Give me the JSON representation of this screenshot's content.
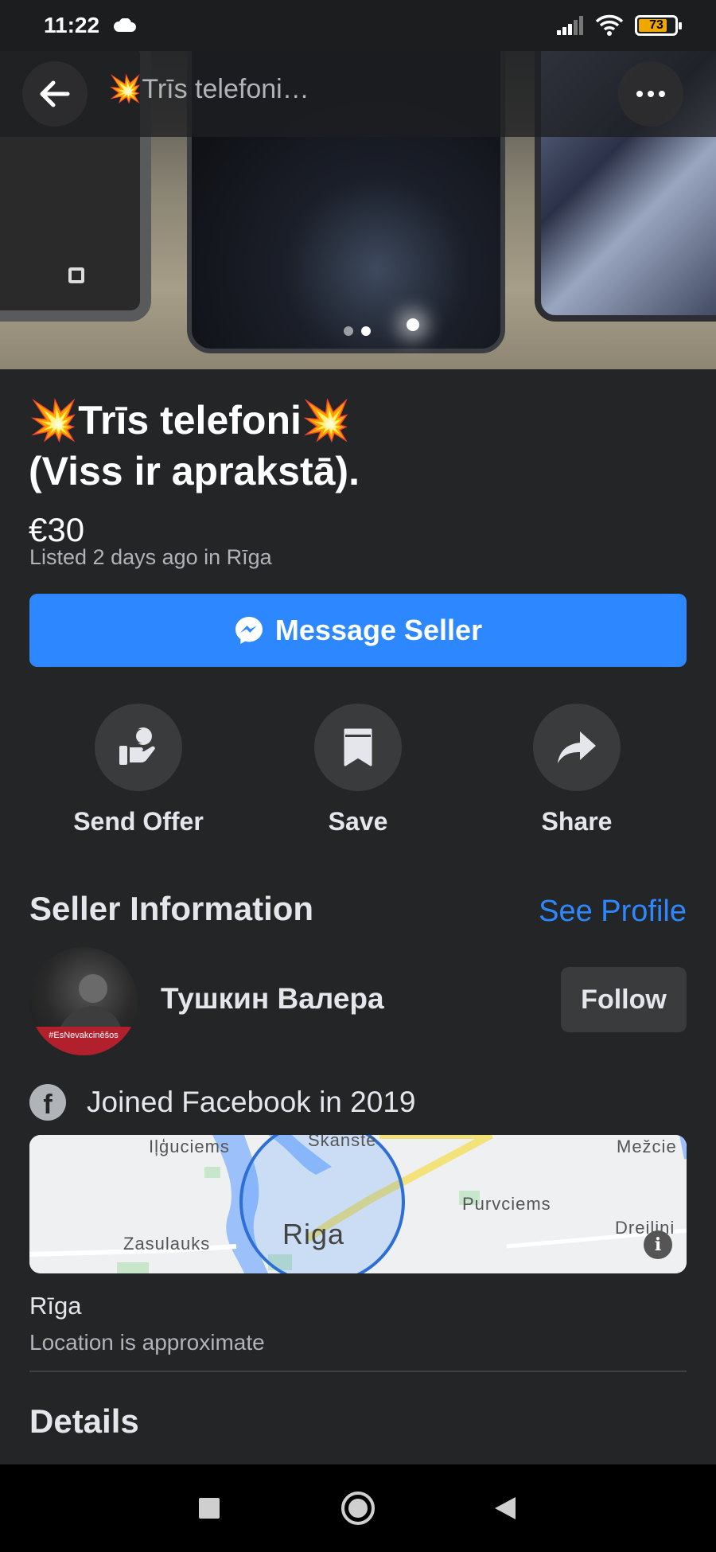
{
  "status_bar": {
    "time": "11:22",
    "battery": "73"
  },
  "header": {
    "title": "💥Trīs telefoni…"
  },
  "hero": {
    "image_count": 2,
    "active_index": 2
  },
  "listing": {
    "title_line1": "💥Trīs telefoni💥",
    "title_line2": "(Viss ir aprakstā).",
    "price": "€30",
    "listed": "Listed 2 days ago in Rīga"
  },
  "message_button": {
    "label": "Message Seller"
  },
  "actions": [
    {
      "label": "Send Offer",
      "icon": "offer-icon"
    },
    {
      "label": "Save",
      "icon": "bookmark-icon"
    },
    {
      "label": "Share",
      "icon": "share-icon"
    }
  ],
  "seller": {
    "heading": "Seller Information",
    "see_profile": "See Profile",
    "name": "Тушкин Валера",
    "avatar_badge": "#EsNevakcinēšos",
    "follow": "Follow",
    "joined": "Joined Facebook in 2019"
  },
  "map": {
    "labels": [
      "Iļģuciems",
      "Skanste",
      "Mežcie",
      "Purvciems",
      "Zasulauks",
      "Riga",
      "Dreilini"
    ]
  },
  "location": {
    "name": "Rīga",
    "note": "Location is approximate"
  },
  "details": {
    "heading": "Details"
  },
  "colors": {
    "accent": "#2d88ff",
    "background": "#242526",
    "button": "#3a3b3c"
  }
}
